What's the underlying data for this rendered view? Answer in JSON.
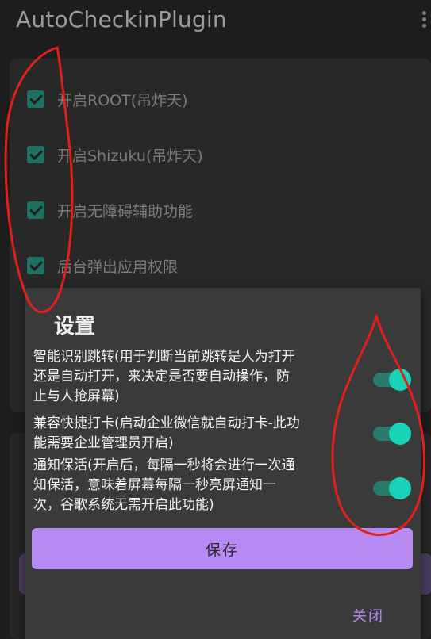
{
  "app": {
    "title": "AutoCheckinPlugin"
  },
  "options": [
    {
      "label": "开启ROOT(吊炸天)",
      "checked": true
    },
    {
      "label": "开启Shizuku(吊炸天)",
      "checked": true
    },
    {
      "label": "开启无障碍辅助功能",
      "checked": true
    },
    {
      "label": "后台弹出应用权限",
      "checked": true
    }
  ],
  "dialog": {
    "title": "设置",
    "settings": [
      {
        "lines": [
          "智能识别跳转(用于判断当前跳转是人为打开",
          "还是自动打开，来决定是否要自动操作，防",
          "止与人抢屏幕)"
        ],
        "enabled": true
      },
      {
        "lines": [
          "兼容快捷打卡(启动企业微信就自动打卡-此功",
          "能需要企业管理员开启)"
        ],
        "enabled": true
      },
      {
        "lines": [
          "通知保活(开启后，每隔一秒将会进行一次通",
          "知保活，意味着屏幕每隔一秒亮屏通知一",
          "次，谷歌系统无需开启此功能)"
        ],
        "enabled": true
      }
    ],
    "save_label": "保存",
    "close_label": "关闭"
  },
  "colors": {
    "accent": "#b68af2",
    "toggle_on": "#19d3b8",
    "checkbox": "#1f6f63",
    "annotation": "#e0201a"
  }
}
